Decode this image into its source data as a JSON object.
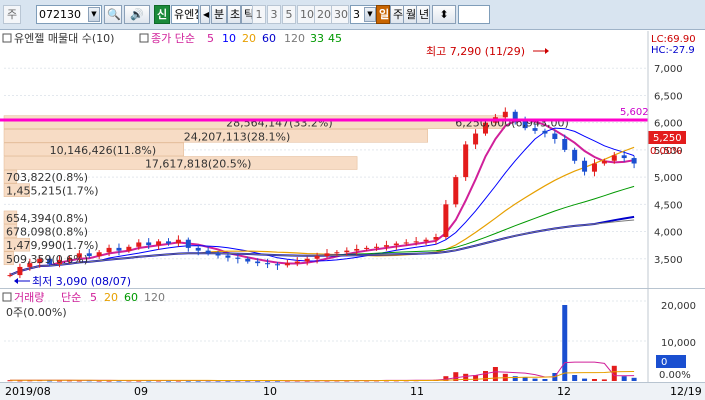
{
  "toolbar": {
    "prefix": "주",
    "stock_code": "072130",
    "sin_label": "신",
    "stock_name": "유엔젤",
    "tabs": [
      "분",
      "초",
      "틱"
    ],
    "intervals": [
      "1",
      "3",
      "5",
      "10",
      "20",
      "30"
    ],
    "interval_value": "3",
    "il_label": "일",
    "period_labels": [
      "주",
      "월",
      "년"
    ],
    "number_field": ""
  },
  "price_panel": {
    "legend_title": "유엔젤 매물대 수(10)",
    "ma_label": "종가 단순",
    "ma_periods": [
      "5",
      "10",
      "20",
      "60",
      "120",
      "33",
      "45"
    ],
    "ma_colors": [
      "#d0209a",
      "#0000ff",
      "#e7a000",
      "#0000cc",
      "#7a7a7a",
      "#009900",
      "#009900"
    ],
    "y_ticks": [
      "7,000",
      "6,500",
      "6,000",
      "5,500",
      "5,000",
      "4,500",
      "4,000",
      "3,500"
    ],
    "y_tick_values": [
      7000,
      6500,
      6000,
      5500,
      5000,
      4500,
      4000,
      3500
    ],
    "corner_lc": "LC:69.90",
    "corner_hc": "HC:-27.9",
    "high_label": "최고 7,290 (11/29)",
    "low_label": "최저 3,090 (08/07)",
    "resistance_value": "5,602",
    "current_price": "5,250",
    "current_change": "0.00%",
    "volume_profile": [
      {
        "label": "28,564,147(33.2%)",
        "price": 6000,
        "width": 0.78
      },
      {
        "label": "24,207,113(28.1%)",
        "price": 5750,
        "width": 0.66
      },
      {
        "label": "10,146,426(11.8%)",
        "price": 5500,
        "width": 0.28
      },
      {
        "label": "17,617,818(20.5%)",
        "price": 5250,
        "width": 0.55
      },
      {
        "label": "703,822(0.8%)",
        "price": 5000,
        "width": 0.02
      },
      {
        "label": "1,455,215(1.7%)",
        "price": 4750,
        "width": 0.04
      },
      {
        "label": "654,394(0.8%)",
        "price": 4250,
        "width": 0.02
      },
      {
        "label": "678,098(0.8%)",
        "price": 4000,
        "width": 0.02
      },
      {
        "label": "1,479,990(1.7%)",
        "price": 3750,
        "width": 0.04
      },
      {
        "label": "509,359(0.6%)",
        "price": 3500,
        "width": 0.015
      }
    ],
    "overlay_label": "6,250,000(6,943,00)"
  },
  "volume_panel": {
    "legend_title": "거래량",
    "ma_label": "단순",
    "ma_periods": [
      "5",
      "20",
      "60",
      "120"
    ],
    "ma_colors": [
      "#d0209a",
      "#e7a000",
      "#009900",
      "#7a7a7a"
    ],
    "summary": "0주(0.00%)",
    "y_ticks": [
      "20,000",
      "10,000"
    ],
    "current_value": "0",
    "current_pct": "0.00%"
  },
  "x_axis": {
    "labels": [
      "2019/08",
      "09",
      "10",
      "11",
      "12"
    ],
    "end_label": "12/19"
  },
  "chart_data": {
    "type": "candlestick",
    "title": "",
    "ylim": [
      3000,
      7500
    ],
    "series": [
      {
        "name": "",
        "values": [
          3200,
          3350,
          3420,
          3500,
          3400,
          3480,
          3520,
          3600,
          3550,
          3620,
          3700,
          3650,
          3720,
          3800,
          3750,
          3820,
          3780,
          3850,
          3700,
          3650,
          3600,
          3560,
          3520,
          3500,
          3450,
          3420,
          3400,
          3380,
          3420,
          3450,
          3500,
          3550,
          3600,
          3620,
          3650,
          3680,
          3700,
          3720,
          3750,
          3780,
          3800,
          3820,
          3850,
          3900,
          4500,
          5000,
          5600,
          5800,
          6000,
          6100,
          6200,
          6050,
          5900,
          5850,
          5800,
          5700,
          5500,
          5300,
          5100,
          5250,
          5300,
          5400,
          5350,
          5250
        ]
      }
    ],
    "volume_values": [
      200,
      150,
      180,
      220,
      150,
      130,
      160,
      140,
      170,
      120,
      110,
      130,
      150,
      120,
      140,
      130,
      110,
      120,
      100,
      110,
      120,
      100,
      90,
      110,
      100,
      90,
      80,
      90,
      100,
      110,
      100,
      120,
      110,
      130,
      120,
      140,
      130,
      150,
      160,
      170,
      180,
      200,
      250,
      300,
      1200,
      2200,
      1800,
      1500,
      2500,
      3500,
      1800,
      1200,
      900,
      600,
      500,
      2000,
      19000,
      1500,
      600,
      500,
      400,
      3800,
      1200,
      800
    ]
  }
}
